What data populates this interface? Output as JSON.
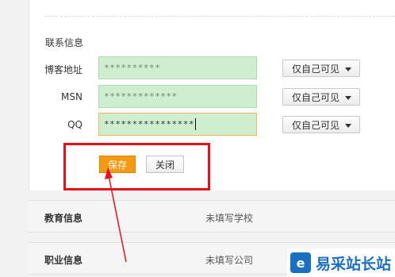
{
  "contact": {
    "section_title": "联系信息",
    "rows": [
      {
        "label": "博客地址",
        "value": "**********",
        "privacy": "仅自己可见"
      },
      {
        "label": "MSN",
        "value": "*************",
        "privacy": "仅自己可见"
      },
      {
        "label": "QQ",
        "value": "****************",
        "privacy": "仅自己可见"
      }
    ],
    "save_label": "保存",
    "close_label": "关闭"
  },
  "sections": [
    {
      "title": "教育信息",
      "value": "未填写学校"
    },
    {
      "title": "职业信息",
      "value": "未填写公司"
    }
  ],
  "watermark": {
    "logo_glyph": "e",
    "text": "易采站长站"
  },
  "colors": {
    "save_button": "#f59a10",
    "input_fill": "#cdeecf",
    "annotation_red": "#e8101a",
    "brand_blue": "#1a6fc1"
  },
  "icons": [
    "dropdown-arrow-icon",
    "annotation-arrow-icon",
    "site-logo-icon"
  ]
}
